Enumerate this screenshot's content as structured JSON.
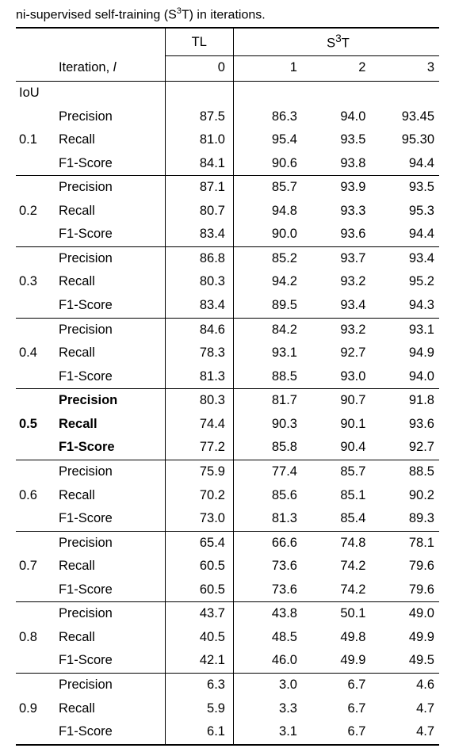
{
  "caption_prefix": "ni-supervised self-training (S",
  "caption_sup": "3",
  "caption_suffix": "T) in iterations.",
  "header": {
    "tl": "TL",
    "s3t_label": "S",
    "s3t_sup": "3",
    "s3t_tail": "T",
    "iteration_label_a": "Iteration, ",
    "iteration_label_b": "l",
    "it0": "0",
    "it1": "1",
    "it2": "2",
    "it3": "3"
  },
  "section_label": "IoU",
  "metrics": {
    "p": "Precision",
    "r": "Recall",
    "f": "F1-Score"
  },
  "chart_data": {
    "type": "table",
    "rows": [
      {
        "iou": "0.1",
        "bold": false,
        "p": [
          "87.5",
          "86.3",
          "94.0",
          "93.45"
        ],
        "r": [
          "81.0",
          "95.4",
          "93.5",
          "95.30"
        ],
        "f": [
          "84.1",
          "90.6",
          "93.8",
          "94.4"
        ]
      },
      {
        "iou": "0.2",
        "bold": false,
        "p": [
          "87.1",
          "85.7",
          "93.9",
          "93.5"
        ],
        "r": [
          "80.7",
          "94.8",
          "93.3",
          "95.3"
        ],
        "f": [
          "83.4",
          "90.0",
          "93.6",
          "94.4"
        ]
      },
      {
        "iou": "0.3",
        "bold": false,
        "p": [
          "86.8",
          "85.2",
          "93.7",
          "93.4"
        ],
        "r": [
          "80.3",
          "94.2",
          "93.2",
          "95.2"
        ],
        "f": [
          "83.4",
          "89.5",
          "93.4",
          "94.3"
        ]
      },
      {
        "iou": "0.4",
        "bold": false,
        "p": [
          "84.6",
          "84.2",
          "93.2",
          "93.1"
        ],
        "r": [
          "78.3",
          "93.1",
          "92.7",
          "94.9"
        ],
        "f": [
          "81.3",
          "88.5",
          "93.0",
          "94.0"
        ]
      },
      {
        "iou": "0.5",
        "bold": true,
        "p": [
          "80.3",
          "81.7",
          "90.7",
          "91.8"
        ],
        "r": [
          "74.4",
          "90.3",
          "90.1",
          "93.6"
        ],
        "f": [
          "77.2",
          "85.8",
          "90.4",
          "92.7"
        ]
      },
      {
        "iou": "0.6",
        "bold": false,
        "p": [
          "75.9",
          "77.4",
          "85.7",
          "88.5"
        ],
        "r": [
          "70.2",
          "85.6",
          "85.1",
          "90.2"
        ],
        "f": [
          "73.0",
          "81.3",
          "85.4",
          "89.3"
        ]
      },
      {
        "iou": "0.7",
        "bold": false,
        "p": [
          "65.4",
          "66.6",
          "74.8",
          "78.1"
        ],
        "r": [
          "60.5",
          "73.6",
          "74.2",
          "79.6"
        ],
        "f": [
          "60.5",
          "73.6",
          "74.2",
          "79.6"
        ]
      },
      {
        "iou": "0.8",
        "bold": false,
        "p": [
          "43.7",
          "43.8",
          "50.1",
          "49.0"
        ],
        "r": [
          "40.5",
          "48.5",
          "49.8",
          "49.9"
        ],
        "f": [
          "42.1",
          "46.0",
          "49.9",
          "49.5"
        ]
      },
      {
        "iou": "0.9",
        "bold": false,
        "p": [
          "6.3",
          "3.0",
          "6.7",
          "4.6"
        ],
        "r": [
          "5.9",
          "3.3",
          "6.7",
          "4.7"
        ],
        "f": [
          "6.1",
          "3.1",
          "6.7",
          "4.7"
        ]
      }
    ]
  }
}
